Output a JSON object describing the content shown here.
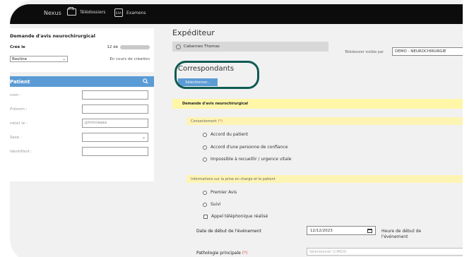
{
  "topnav": {
    "brand": "Nexus",
    "teledossiers": "Télédossiers",
    "examens": "Examens",
    "exam_icon_text": "EXA"
  },
  "request": {
    "title": "Demande d'avis neurochirurgical",
    "created_label": "Créé le",
    "created_value": "12 dé",
    "priority": "Routine",
    "status": "En cours de création"
  },
  "patient": {
    "header": "Patient",
    "fields": [
      {
        "label": "nom :",
        "value": ""
      },
      {
        "label": "Prénom :",
        "value": ""
      },
      {
        "label": "né(e) le :",
        "value": "jj/mm/aaaa"
      },
      {
        "label": "Sexe :",
        "value": ""
      },
      {
        "label": "Identifiant :",
        "value": ""
      }
    ]
  },
  "expediteur": {
    "title": "Expéditeur",
    "name": "Cabannes Thomas",
    "visible_label": "Télédossier visible par",
    "visible_value": "DEMO - NEUROCHIRURGIE"
  },
  "correspondants": {
    "title": "Correspondants",
    "select_button": "Sélectionner..."
  },
  "form": {
    "section_title": "Demande d'avis neurochirurgical",
    "consent_label": "Consentement",
    "consent_required": "(*)",
    "consent_options": [
      "Accord du patient",
      "Accord d'une personne de confiance",
      "Impossible à recueillir / urgence vitale"
    ],
    "info_label": "Informations sur la prise en charge et le patient",
    "info_options": [
      "Premier Avis",
      "Suivi"
    ],
    "phone_check": "Appel téléphonique réalisé",
    "date_label": "Date de début de l'événement",
    "date_value": "12/12/2023",
    "hour_label": "Heure de début de l'événement",
    "pathology_label": "Pathologie principale",
    "pathology_required": "(*)",
    "pathology_placeholder": "Sélectionner (CIM10)"
  }
}
